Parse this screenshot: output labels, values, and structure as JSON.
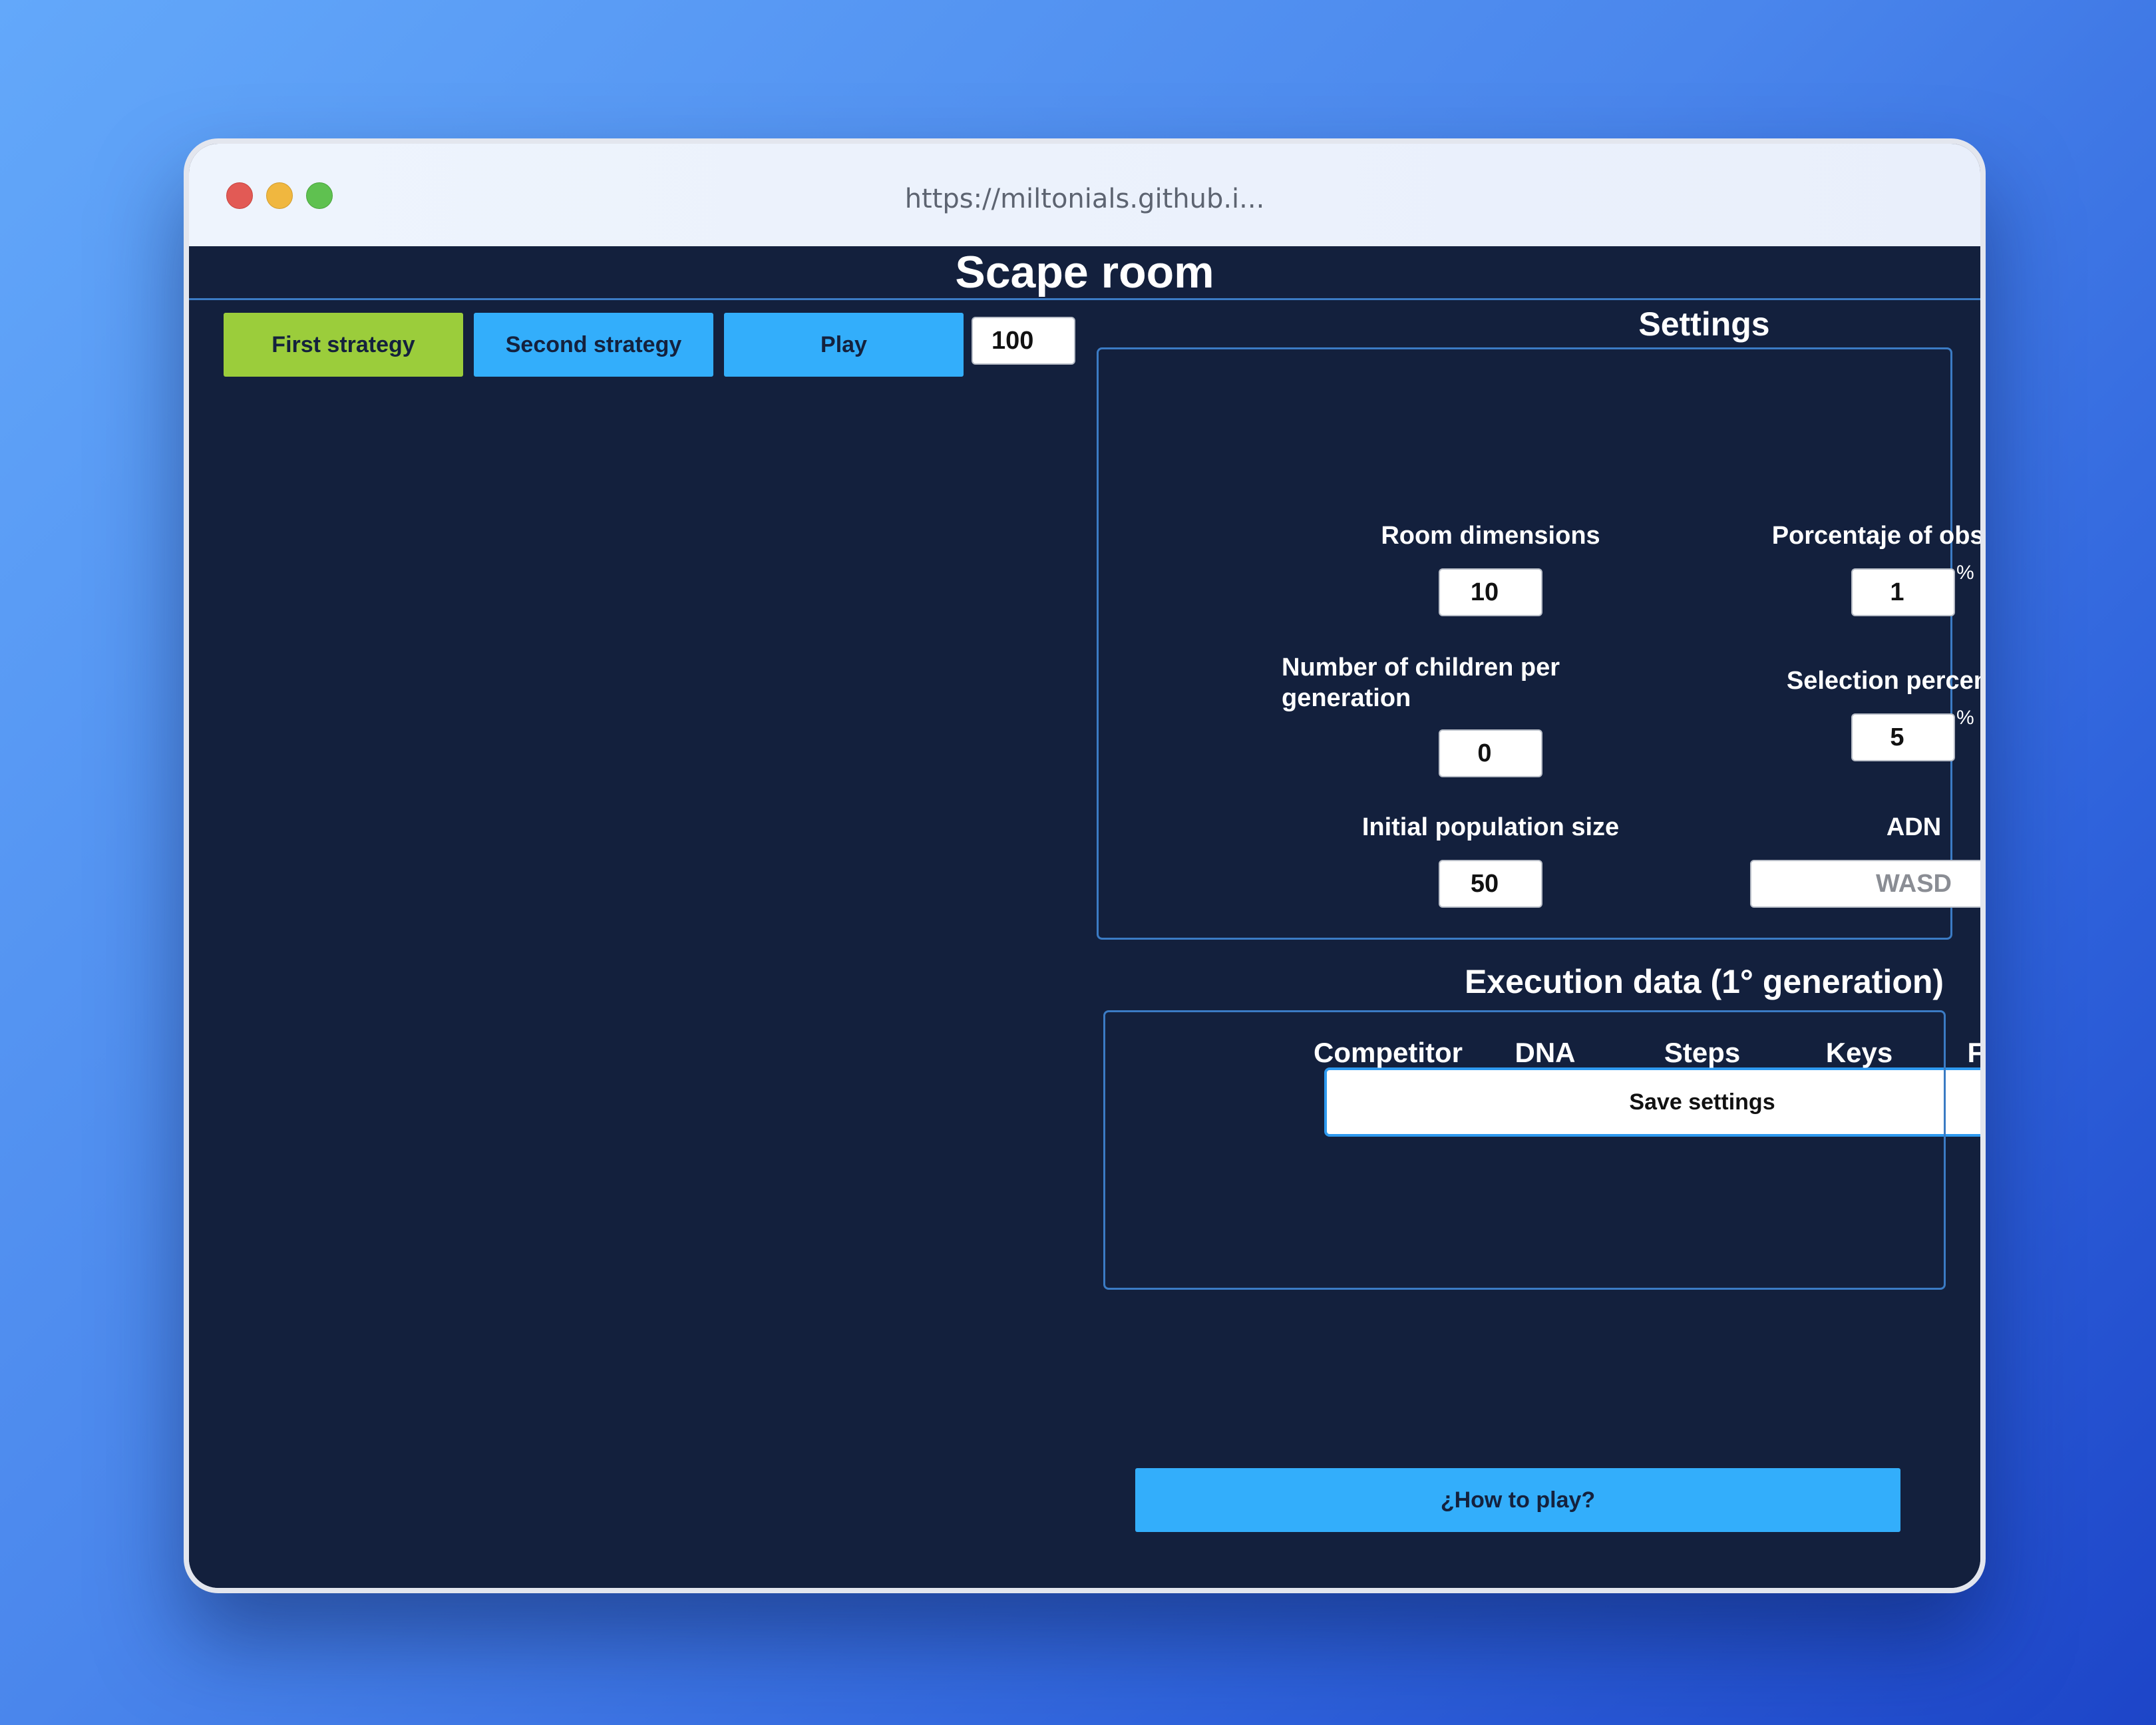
{
  "browser": {
    "url": "https://miltonials.github.i..."
  },
  "app": {
    "title": "Scape room"
  },
  "toolbar": {
    "first_strategy_label": "First strategy",
    "second_strategy_label": "Second strategy",
    "play_label": "Play",
    "speed_value": "100"
  },
  "settings": {
    "title": "Settings",
    "room_dimensions": {
      "label": "Room dimensions",
      "value": "10"
    },
    "obstacles": {
      "label": "Porcentaje of obstacles",
      "value": "1",
      "unit": "%"
    },
    "children": {
      "label": "Number of children per generation",
      "value": "0"
    },
    "selection": {
      "label": "Selection percentage",
      "value": "5",
      "unit": "%"
    },
    "population": {
      "label": "Initial population size",
      "value": "50"
    },
    "dna": {
      "label": "ADN",
      "placeholder": "WASD"
    },
    "save_label": "Save settings"
  },
  "execution": {
    "title": "Execution data (1° generation)",
    "columns": [
      "Competitor",
      "DNA",
      "Steps",
      "Keys",
      "Fitness"
    ]
  },
  "help": {
    "how_to_play_label": "¿How to play?"
  },
  "colors": {
    "background": "#13203d",
    "primary_button": "#33aefb",
    "active_button": "#9bcd3b",
    "border_accent": "#3b7bc4"
  }
}
